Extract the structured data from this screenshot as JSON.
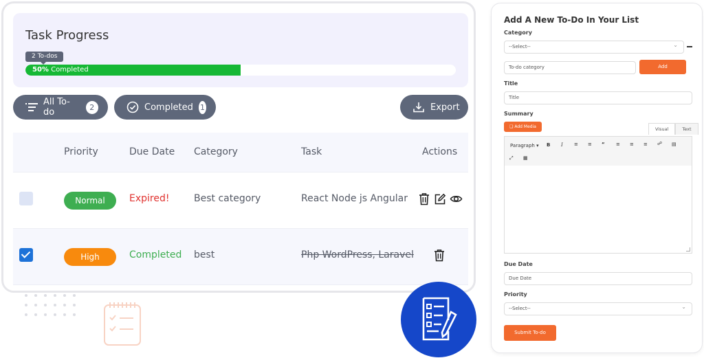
{
  "progress": {
    "title": "Task Progress",
    "tooltip": "2 To-dos",
    "percent_label": "50%",
    "completed_label": "Completed",
    "fraction": 0.5,
    "fill_color": "#16b835"
  },
  "filters": {
    "all_label": "All To-do",
    "all_count": "2",
    "completed_label": "Completed",
    "completed_count": "1",
    "export_label": "Export"
  },
  "table": {
    "headers": [
      "Priority",
      "Due Date",
      "Category",
      "Task",
      "Actions"
    ],
    "rows": [
      {
        "checked": false,
        "priority": "Normal",
        "priority_color": "#3eae51",
        "due": "Expired!",
        "due_color": "#e0312e",
        "category": "Best category",
        "task": "React Node js Angular",
        "strikethrough": false,
        "actions": [
          "trash-icon",
          "edit-icon",
          "eye-icon"
        ]
      },
      {
        "checked": true,
        "priority": "High",
        "priority_color": "#f88a0d",
        "due": "Completed",
        "due_color": "#3eae51",
        "category": "best",
        "task": "Php WordPress, Laravel",
        "strikethrough": true,
        "actions": [
          "trash-icon"
        ]
      }
    ]
  },
  "form": {
    "title": "Add A New To-Do In Your List",
    "category_label": "Category",
    "category_select": "--Select--",
    "new_category_placeholder": "To-do category",
    "add_button": "Add",
    "title_label": "Title",
    "title_placeholder": "Title",
    "summary_label": "Summary",
    "add_media_button": "Add Media",
    "tab_visual": "Visual",
    "tab_text": "Text",
    "toolbar_format": "Paragraph",
    "due_label": "Due Date",
    "due_placeholder": "Due Date",
    "priority_label": "Priority",
    "priority_select": "--Select--",
    "submit_button": "Submit To-do"
  },
  "colors": {
    "accent_orange": "#f26a2e",
    "pill_gray": "#5e677a",
    "brand_blue": "#1547c9"
  }
}
